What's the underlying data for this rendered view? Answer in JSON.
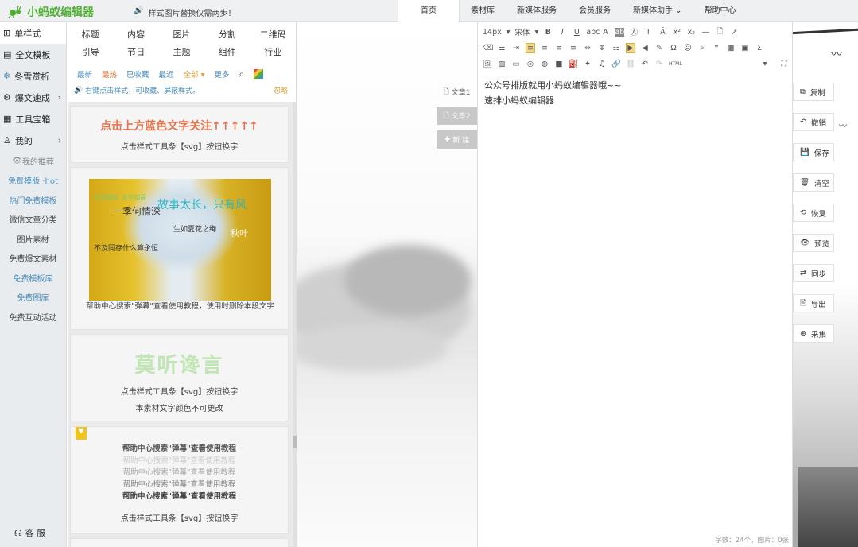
{
  "app": {
    "logo_text": "小蚂蚁编辑器",
    "notice": "样式图片替换仅需两步！"
  },
  "nav": {
    "items": [
      "首页",
      "素材库",
      "新媒体服务",
      "会员服务",
      "新媒体助手 ⌄",
      "帮助中心"
    ],
    "active_index": 0
  },
  "sidebar": {
    "items": [
      {
        "label": "单样式",
        "icon": "grid-icon"
      },
      {
        "label": "全文模板",
        "icon": "template-icon"
      },
      {
        "label": "冬雪赏析",
        "icon": "snowflake-icon"
      },
      {
        "label": "爆文速成",
        "icon": "gear-icon"
      },
      {
        "label": "工具宝箱",
        "icon": "toolbox-icon"
      },
      {
        "label": "我的",
        "icon": "user-icon"
      }
    ],
    "subs": [
      "我的推荐",
      "免费模版 ·hot",
      "热门免费模板",
      "微信文章分类",
      "图片素材",
      "免费爆文素材",
      "免费模板库",
      "免费图库",
      "免费互动活动"
    ],
    "service": "客 服"
  },
  "panel": {
    "categories": [
      "标题",
      "内容",
      "图片",
      "分割",
      "二维码",
      "引导",
      "节日",
      "主题",
      "组件",
      "行业"
    ],
    "filters": [
      "最新",
      "最热",
      "已收藏",
      "最近",
      "全部 ▾",
      "更多"
    ],
    "hint": "右键点击样式，可收藏、屏蔽样式。",
    "ignore": "忽略",
    "card1": {
      "title": "点击上方蓝色文字关注↑↑↑↑↑",
      "sub": "点击样式工具条【svg】按钮换字"
    },
    "card2": {
      "img_lines": [
        "天涯路远 见字如面",
        "一季何情深",
        "故事太长，只有风",
        "生如夏花之绚",
        "秋叶",
        "不及同存什么算永恒"
      ],
      "caption": "帮助中心搜索\"弹幕\"查看使用教程，使用时删除本段文字"
    },
    "card3": {
      "title": "莫听谗言",
      "sub1": "点击样式工具条【svg】按钮换字",
      "sub2": "本素材文字颜色不可更改"
    },
    "card4": {
      "lines": [
        "帮助中心搜索\"弹幕\"查看使用教程",
        "帮助中心搜索\"弹幕\"查看使用教程",
        "帮助中心搜索\"弹幕\"查看使用教程",
        "帮助中心搜索\"弹幕\"查看使用教程",
        "帮助中心搜索\"弹幕\"查看使用教程"
      ],
      "sub": "点击样式工具条【svg】按钮换字"
    }
  },
  "articles": {
    "tab1": "文章1",
    "tab2": "文章2",
    "new": "新 建"
  },
  "editor": {
    "font_size": "14px",
    "font_family": "宋体",
    "lines": [
      "公众号排版就用小蚂蚁编辑器哦~~",
      "速排小蚂蚁编辑器"
    ],
    "counter": "字数：24个，图片：0张"
  },
  "actions": [
    "复制",
    "撤销",
    "保存",
    "清空",
    "恢复",
    "预览",
    "同步",
    "导出",
    "采集"
  ]
}
